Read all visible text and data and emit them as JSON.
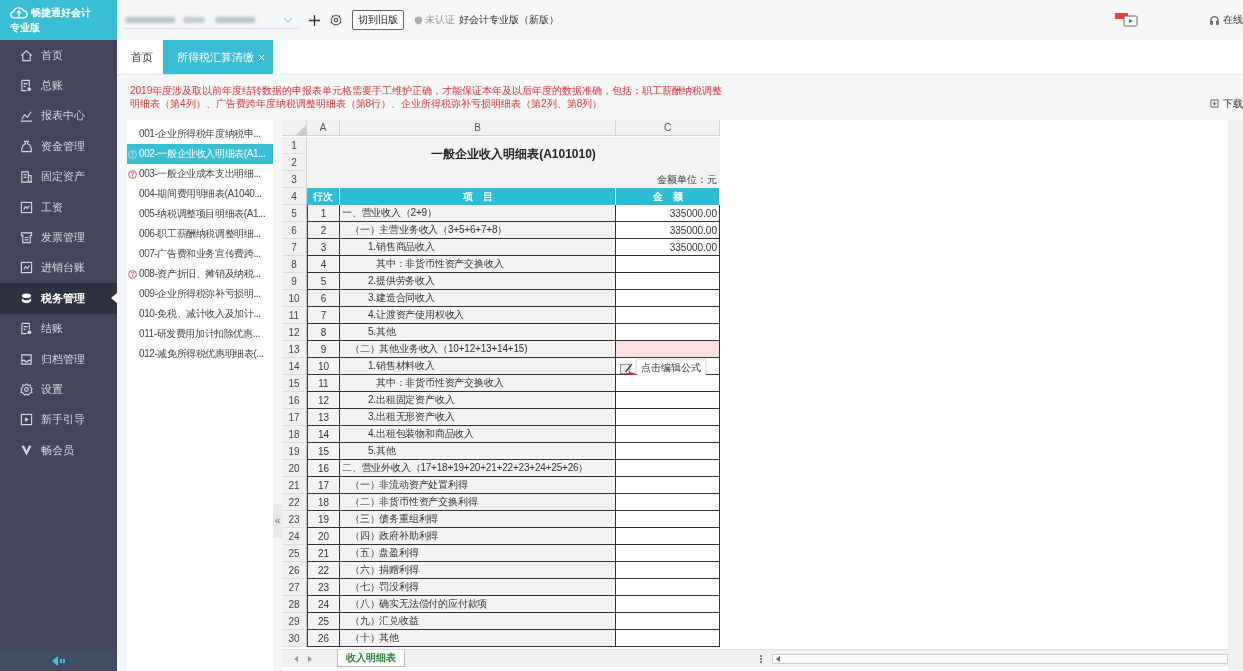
{
  "logo": {
    "name": "畅捷通好会计",
    "edition": "专业版"
  },
  "sidebar": {
    "items": [
      {
        "label": "首页",
        "selected": false
      },
      {
        "label": "总账",
        "selected": false
      },
      {
        "label": "报表中心",
        "selected": false
      },
      {
        "label": "资金管理",
        "selected": false
      },
      {
        "label": "固定资产",
        "selected": false
      },
      {
        "label": "工资",
        "selected": false
      },
      {
        "label": "发票管理",
        "selected": false
      },
      {
        "label": "进销台账",
        "selected": false
      },
      {
        "label": "税务管理",
        "selected": true
      },
      {
        "label": "结账",
        "selected": false
      },
      {
        "label": "归档管理",
        "selected": false
      },
      {
        "label": "设置",
        "selected": false
      },
      {
        "label": "新手引导",
        "selected": false
      },
      {
        "label": "畅会员",
        "selected": false
      }
    ]
  },
  "toolbar": {
    "old_version_button": "切到旧版",
    "certification": "未认证",
    "product": "好会计专业版（新版）",
    "service": "在线"
  },
  "tabs": [
    {
      "label": "首页",
      "selected": false,
      "closable": false
    },
    {
      "label": "所得税汇算清缴",
      "selected": true,
      "closable": true
    }
  ],
  "notice": "2019年度涉及取以前年度结转数据的申报表单元格需要手工维护正确，才能保证本年及以后年度的数据准确，包括：职工薪酬纳税调整明细表（第4列）、广告费跨年度纳税调整明细表（第8行）、企业所得税弥补亏损明细表（第2列、第8列）",
  "download": "下载",
  "collapse_handle": "«",
  "report_list": [
    {
      "label": "001-企业所得税年度纳税申...",
      "selected": false,
      "flagged": false
    },
    {
      "label": "002-一般企业收入明细表(A1...",
      "selected": true,
      "flagged": true
    },
    {
      "label": "003-一般企业成本支出明细...",
      "selected": false,
      "flagged": true
    },
    {
      "label": "004-期间费用明细表(A1040...",
      "selected": false,
      "flagged": false
    },
    {
      "label": "005-纳税调整项目明细表(A1...",
      "selected": false,
      "flagged": false
    },
    {
      "label": "006-职工薪酬纳税调整明细...",
      "selected": false,
      "flagged": false
    },
    {
      "label": "007-广告费和业务宣传费跨...",
      "selected": false,
      "flagged": false
    },
    {
      "label": "008-资产折旧、摊销及纳税...",
      "selected": false,
      "flagged": true
    },
    {
      "label": "009-企业所得税弥补亏损明...",
      "selected": false,
      "flagged": false
    },
    {
      "label": "010-免税、减计收入及加计...",
      "selected": false,
      "flagged": false
    },
    {
      "label": "011-研发费用加计扣除优惠...",
      "selected": false,
      "flagged": false
    },
    {
      "label": "012-减免所得税优惠明细表(...",
      "selected": false,
      "flagged": false
    }
  ],
  "sheet": {
    "columns": [
      "A",
      "B",
      "C"
    ],
    "title_rows": [
      "1",
      "2"
    ],
    "title": "一般企业收入明细表(A101010)",
    "unit_row": "3",
    "unit": "金额单位：元",
    "header": {
      "row": "4",
      "cells": [
        "行次",
        "项　目",
        "金　额"
      ]
    },
    "rows": [
      {
        "row": "5",
        "line": "1",
        "item": "一、营业收入（2+9）",
        "amount": "335000.00",
        "kind": "section",
        "selected": false
      },
      {
        "row": "6",
        "line": "2",
        "item": "（一）主营业务收入（3+5+6+7+8）",
        "amount": "335000.00",
        "kind": "group",
        "selected": false
      },
      {
        "row": "7",
        "line": "3",
        "item": "1.销售商品收入",
        "amount": "335000.00",
        "kind": "item",
        "selected": false
      },
      {
        "row": "8",
        "line": "4",
        "item": "其中：非货币性资产交换收入",
        "kind": "subitem",
        "selected": false
      },
      {
        "row": "9",
        "line": "5",
        "item": "2.提供劳务收入",
        "kind": "item",
        "selected": false
      },
      {
        "row": "10",
        "line": "6",
        "item": "3.建造合同收入",
        "kind": "item",
        "selected": false
      },
      {
        "row": "11",
        "line": "7",
        "item": "4.让渡资产使用权收入",
        "kind": "item",
        "selected": false
      },
      {
        "row": "12",
        "line": "8",
        "item": "5.其他",
        "kind": "item",
        "selected": false
      },
      {
        "row": "13",
        "line": "9",
        "item": "（二）其他业务收入（10+12+13+14+15)",
        "kind": "group",
        "selected": true
      },
      {
        "row": "14",
        "line": "10",
        "item": "1.销售材料收入",
        "kind": "item",
        "selected": false,
        "tooltip": "点击编辑公式"
      },
      {
        "row": "15",
        "line": "11",
        "item": "其中：非货币性资产交换收入",
        "kind": "subitem",
        "selected": false
      },
      {
        "row": "16",
        "line": "12",
        "item": "2.出租固定资产收入",
        "kind": "item",
        "selected": false
      },
      {
        "row": "17",
        "line": "13",
        "item": "3.出租无形资产收入",
        "kind": "item",
        "selected": false
      },
      {
        "row": "18",
        "line": "14",
        "item": "4.出租包装物和商品收入",
        "kind": "item",
        "selected": false
      },
      {
        "row": "19",
        "line": "15",
        "item": "5.其他",
        "kind": "item",
        "selected": false
      },
      {
        "row": "20",
        "line": "16",
        "item": "二、营业外收入（17+18+19+20+21+22+23+24+25+26）",
        "kind": "section",
        "selected": false
      },
      {
        "row": "21",
        "line": "17",
        "item": "（一）非流动资产处置利得",
        "kind": "group",
        "selected": false
      },
      {
        "row": "22",
        "line": "18",
        "item": "（二）非货币性资产交换利得",
        "kind": "group",
        "selected": false
      },
      {
        "row": "23",
        "line": "19",
        "item": "（三）债务重组利得",
        "kind": "group",
        "selected": false
      },
      {
        "row": "24",
        "line": "20",
        "item": "（四）政府补助利得",
        "kind": "group",
        "selected": false
      },
      {
        "row": "25",
        "line": "21",
        "item": "（五）盘盈利得",
        "kind": "group",
        "selected": false
      },
      {
        "row": "26",
        "line": "22",
        "item": "（六）捐赠利得",
        "kind": "group",
        "selected": false
      },
      {
        "row": "27",
        "line": "23",
        "item": "（七）罚没利得",
        "kind": "group",
        "selected": false
      },
      {
        "row": "28",
        "line": "24",
        "item": "（八）确实无法偿付的应付款项",
        "kind": "group",
        "selected": false
      },
      {
        "row": "29",
        "line": "25",
        "item": "（九）汇兑收益",
        "kind": "group",
        "selected": false
      },
      {
        "row": "30",
        "line": "26",
        "item": "（十）其他",
        "kind": "group",
        "selected": false
      }
    ]
  },
  "sheet_tabs": [
    {
      "label": "收入明细表",
      "selected": true
    }
  ]
}
